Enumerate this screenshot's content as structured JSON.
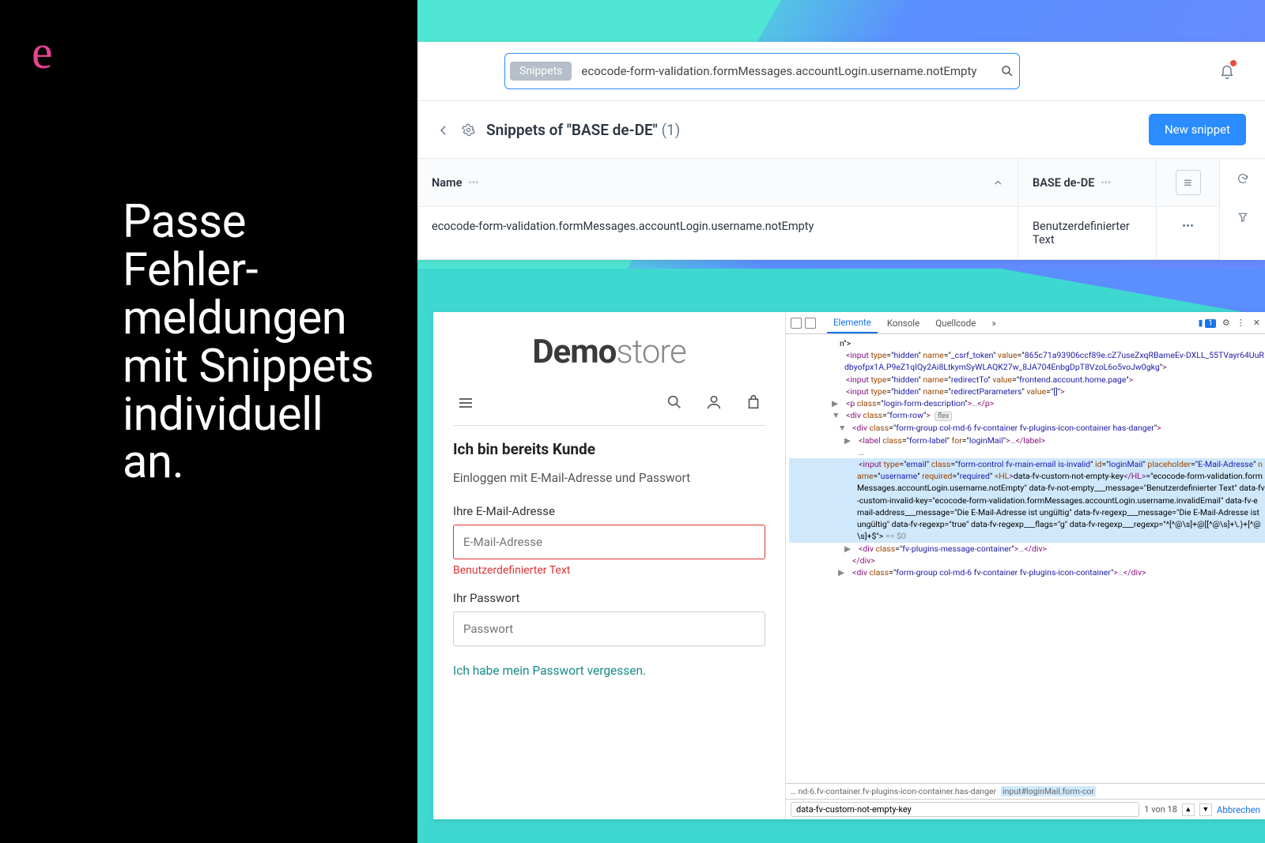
{
  "left": {
    "logo": "e",
    "headline": "Passe Fehler-\nmeldungen mit Snippets individuell an."
  },
  "admin": {
    "search": {
      "tag": "Snippets",
      "value": "ecocode-form-validation.formMessages.accountLogin.username.notEmpty"
    },
    "title_prefix": "Snippets of \"BASE de-DE\" ",
    "title_count": "(1)",
    "new_button": "New snippet",
    "columns": {
      "name": "Name",
      "base": "BASE de-DE"
    },
    "row": {
      "name": "ecocode-form-validation.formMessages.accountLogin.username.notEmpty",
      "base": "Benutzerdefinierter Text"
    }
  },
  "store": {
    "logo_bold": "Demo",
    "logo_light": "store",
    "h2": "Ich bin bereits Kunde",
    "sub": "Einloggen mit E-Mail-Adresse und Passwort",
    "email_label": "Ihre E-Mail-Adresse",
    "email_placeholder": "E-Mail-Adresse",
    "email_error": "Benutzerdefinierter Text",
    "pw_label": "Ihr Passwort",
    "pw_placeholder": "Passwort",
    "forgot": "Ich habe mein Passwort vergessen."
  },
  "devtools": {
    "tabs": {
      "elements": "Elemente",
      "console": "Konsole",
      "source": "Quellcode"
    },
    "badge_count": "1",
    "breadcrumb_left": "…  nd-6.fv-container.fv-plugins-icon-container.has-danger",
    "breadcrumb_sel": "input#loginMail.form-cor",
    "search_value": "data-fv-custom-not-empty-key",
    "search_count": "1 von 18",
    "cancel": "Abbrechen",
    "lines": [
      {
        "ind": 6,
        "html": "n\">"
      },
      {
        "ind": 7,
        "html": "<input type=\"hidden\" name=\"_csrf_token\" value=\"865c71a93906ccf89e.cZ7useZxqRBameEv-DXLL_55TVayr64UuRdbyofpx1A.P9eZ1qIQy2Ai8LtkymSyWLAQK27w_8JA704EnbgDpT8VzoL6o5voJw0gkg\">"
      },
      {
        "ind": 7,
        "html": "<input type=\"hidden\" name=\"redirectTo\" value=\"frontend.account.home.page\">"
      },
      {
        "ind": 7,
        "html": "<input type=\"hidden\" name=\"redirectParameters\" value=\"[]\">"
      },
      {
        "ind": 7,
        "tri": "▶",
        "html": "<p class=\"login-form-description\">…</p>"
      },
      {
        "ind": 7,
        "tri": "▼",
        "html": "<div class=\"form-row\"> [flex]"
      },
      {
        "ind": 8,
        "tri": "▼",
        "html": "<div class=\"form-group col-md-6 fv-container fv-plugins-icon-container has-danger\">"
      },
      {
        "ind": 9,
        "tri": "▶",
        "html": "<label class=\"form-label\" for=\"loginMail\">…</label>"
      },
      {
        "ind": 9,
        "tri": "",
        "grey": "…"
      },
      {
        "ind": 9,
        "sel": true,
        "html": "<input type=\"email\" class=\"form-control fv-main-email is-invalid\" id=\"loginMail\" placeholder=\"E-Mail-Adresse\" name=\"username\" required=\"required\" <HL>data-fv-custom-not-empty-key</HL>=\"ecocode-form-validation.formMessages.accountLogin.username.notEmpty\" data-fv-not-empty___message=\"Benutzerdefinierter Text\" data-fv-custom-invalid-key=\"ecocode-form-validation.formMessages.accountLogin.username.invalidEmail\" data-fv-email-address___message=\"Die E-Mail-Adresse ist ungültig\" data-fv-regexp___message=\"Die E-Mail-Adresse ist ungültig\" data-fv-regexp=\"true\" data-fv-regexp___flags=\"g\" data-fv-regexp___regexp=\"^[^@\\s]+@[[^@\\s]+\\.)+[^@\\s]+$\"> == $0"
      },
      {
        "ind": 9,
        "tri": "▶",
        "html": "<div class=\"fv-plugins-message-container\">…</div>"
      },
      {
        "ind": 8,
        "html": "</div>"
      },
      {
        "ind": 8,
        "tri": "▶",
        "html": "<div class=\"form-group col-md-6 fv-container fv-plugins-icon-container\">…</div>"
      }
    ]
  }
}
